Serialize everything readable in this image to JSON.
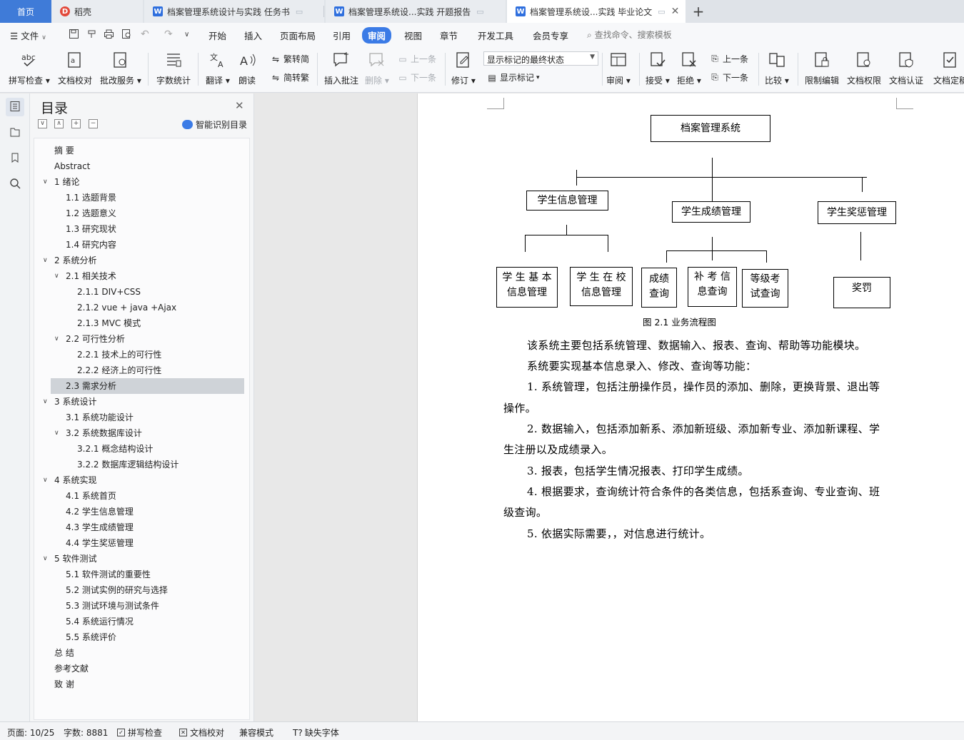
{
  "tabs": {
    "home": "首页",
    "docer": "稻壳",
    "doc1": "档案管理系统设计与实践 任务书",
    "doc2": "档案管理系统设...实践 开题报告",
    "doc3": "档案管理系统设...实践 毕业论文",
    "new_tab": "+"
  },
  "menu": {
    "file": "文件",
    "items": [
      "开始",
      "插入",
      "页面布局",
      "引用",
      "审阅",
      "视图",
      "章节",
      "开发工具",
      "会员专享"
    ],
    "active": "审阅",
    "search": "查找命令、搜索模板"
  },
  "ribbon": {
    "spell_check": "拼写检查",
    "doc_proof": "文档校对",
    "revise_service": "批改服务",
    "word_count": "字数统计",
    "translate": "翻译",
    "read_aloud": "朗读",
    "to_traditional": "繁转简",
    "to_simplified": "简转繁",
    "insert_comment": "插入批注",
    "delete": "删除",
    "prev_comment": "上一条",
    "next_comment": "下一条",
    "track_changes": "修订",
    "markup_state": "显示标记的最终状态",
    "show_markup": "显示标记",
    "review": "审阅",
    "accept": "接受",
    "reject": "拒绝",
    "prev_change": "上一条",
    "next_change": "下一条",
    "compare": "比较",
    "restrict_edit": "限制编辑",
    "doc_permission": "文档权限",
    "doc_auth": "文档认证",
    "doc_finalize": "文档定稿"
  },
  "toc": {
    "title": "目录",
    "smart": "智能识别目录",
    "items": [
      {
        "text": "摘    要",
        "level": 0,
        "caret": ""
      },
      {
        "text": "Abstract",
        "level": 0,
        "caret": ""
      },
      {
        "text": "1 绪论",
        "level": 0,
        "caret": "v"
      },
      {
        "text": "1.1 选题背景",
        "level": 1,
        "caret": ""
      },
      {
        "text": "1.2 选题意义",
        "level": 1,
        "caret": ""
      },
      {
        "text": "1.3 研究现状",
        "level": 1,
        "caret": ""
      },
      {
        "text": "1.4 研究内容",
        "level": 1,
        "caret": ""
      },
      {
        "text": "2 系统分析",
        "level": 0,
        "caret": "v"
      },
      {
        "text": "2.1 相关技术",
        "level": 1,
        "caret": "v"
      },
      {
        "text": "2.1.1 DIV+CSS",
        "level": 2,
        "caret": ""
      },
      {
        "text": "2.1.2 vue + java +Ajax",
        "level": 2,
        "caret": ""
      },
      {
        "text": "2.1.3 MVC 模式",
        "level": 2,
        "caret": ""
      },
      {
        "text": "2.2 可行性分析",
        "level": 1,
        "caret": "v"
      },
      {
        "text": "2.2.1 技术上的可行性",
        "level": 2,
        "caret": ""
      },
      {
        "text": "2.2.2 经济上的可行性",
        "level": 2,
        "caret": ""
      },
      {
        "text": "2.3 需求分析",
        "level": 1,
        "caret": "",
        "selected": true
      },
      {
        "text": "3 系统设计",
        "level": 0,
        "caret": "v"
      },
      {
        "text": "3.1 系统功能设计",
        "level": 1,
        "caret": ""
      },
      {
        "text": "3.2 系统数据库设计",
        "level": 1,
        "caret": "v"
      },
      {
        "text": "3.2.1 概念结构设计",
        "level": 2,
        "caret": ""
      },
      {
        "text": "3.2.2 数据库逻辑结构设计",
        "level": 2,
        "caret": ""
      },
      {
        "text": "4 系统实现",
        "level": 0,
        "caret": "v"
      },
      {
        "text": "4.1 系统首页",
        "level": 1,
        "caret": ""
      },
      {
        "text": "4.2 学生信息管理",
        "level": 1,
        "caret": ""
      },
      {
        "text": "4.3 学生成绩管理",
        "level": 1,
        "caret": ""
      },
      {
        "text": "4.4 学生奖惩管理",
        "level": 1,
        "caret": ""
      },
      {
        "text": "5 软件测试",
        "level": 0,
        "caret": "v"
      },
      {
        "text": "5.1 软件测试的重要性",
        "level": 1,
        "caret": ""
      },
      {
        "text": "5.2 测试实例的研究与选择",
        "level": 1,
        "caret": ""
      },
      {
        "text": "5.3 测试环境与测试条件",
        "level": 1,
        "caret": ""
      },
      {
        "text": "5.4 系统运行情况",
        "level": 1,
        "caret": ""
      },
      {
        "text": "5.5 系统评价",
        "level": 1,
        "caret": ""
      },
      {
        "text": "总    结",
        "level": 0,
        "caret": ""
      },
      {
        "text": "参考文献",
        "level": 0,
        "caret": ""
      },
      {
        "text": "致    谢",
        "level": 0,
        "caret": ""
      }
    ]
  },
  "figure": {
    "root": "档案管理系统",
    "info": "学生信息管理",
    "score": "学生成绩管理",
    "reward": "学生奖惩管理",
    "basic_line1": "学 生 基 本",
    "basic_line2": "信息管理",
    "school_line1": "学 生 在 校",
    "school_line2": "信息管理",
    "grade_line1": "成绩",
    "grade_line2": "查询",
    "makeup_line1": "补 考 信",
    "makeup_line2": "息查询",
    "level_line1": "等级考",
    "level_line2": "试查询",
    "punish": "奖罚",
    "caption": "图 2.1 业务流程图"
  },
  "body_lines": [
    "该系统主要包括系统管理、数据输入、报表、查询、帮助等功能模块。",
    "系统要实现基本信息录入、修改、查询等功能：",
    "1. 系统管理，包括注册操作员，操作员的添加、删除，更换背景、退出等",
    "操作。",
    "2. 数据输入，包括添加新系、添加新班级、添加新专业、添加新课程、学",
    "生注册以及成绩录入。",
    "3. 报表，包括学生情况报表、打印学生成绩。",
    "4. 根据要求，查询统计符合条件的各类信息，包括系查询、专业查询、班",
    "级查询。",
    "5. 依据实际需要，，对信息进行统计。"
  ],
  "status": {
    "page": "页面: 10/25",
    "words": "字数: 8881",
    "spell": "拼写检查",
    "proof": "文档校对",
    "compat": "兼容模式",
    "missing_font": "缺失字体"
  }
}
